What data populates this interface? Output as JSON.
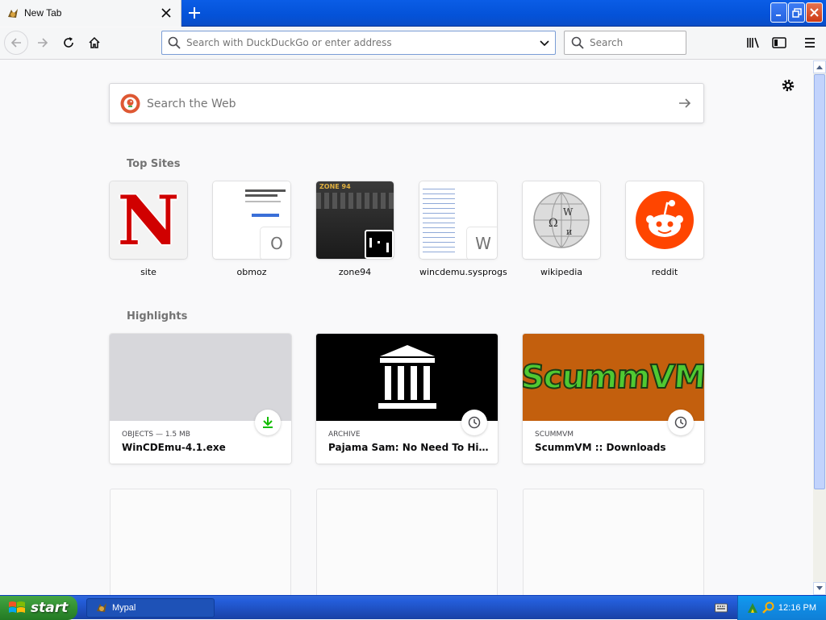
{
  "tab": {
    "title": "New Tab",
    "close": "×"
  },
  "newtab": "+",
  "urlbar": {
    "placeholder": "Search with DuckDuckGo or enter address"
  },
  "searchbar": {
    "placeholder": "Search"
  },
  "websearch": {
    "placeholder": "Search the Web"
  },
  "topsites": {
    "title": "Top Sites",
    "items": [
      {
        "label": "site",
        "glyph": "N"
      },
      {
        "label": "obmoz",
        "glyph": "O"
      },
      {
        "label": "zone94",
        "glyph": "ZONE 94"
      },
      {
        "label": "wincdemu.sysprogs",
        "glyph": "W"
      },
      {
        "label": "wikipedia",
        "glyph": ""
      },
      {
        "label": "reddit",
        "glyph": ""
      }
    ]
  },
  "highlights": {
    "title": "Highlights",
    "items": [
      {
        "context": "OBJECTS — 1.5 MB",
        "title": "WinCDEmu-4.1.exe",
        "icon": "download-icon"
      },
      {
        "context": "ARCHIVE",
        "title": "Pajama Sam: No Need To Hide When It's Dark Outside",
        "icon": "clock-icon"
      },
      {
        "context": "SCUMMVM",
        "title": "ScummVM :: Downloads",
        "icon": "clock-icon",
        "logo": "ScummVM"
      }
    ]
  },
  "taskbar": {
    "start": "start",
    "task": "Mypal",
    "clock": "12:16 PM"
  },
  "colors": {
    "accent": "#0a84ff",
    "download": "#12bc00",
    "reddit": "#ff4500",
    "scummvm_bg": "#c35f0d",
    "tabstrip": "#0a5de6"
  }
}
